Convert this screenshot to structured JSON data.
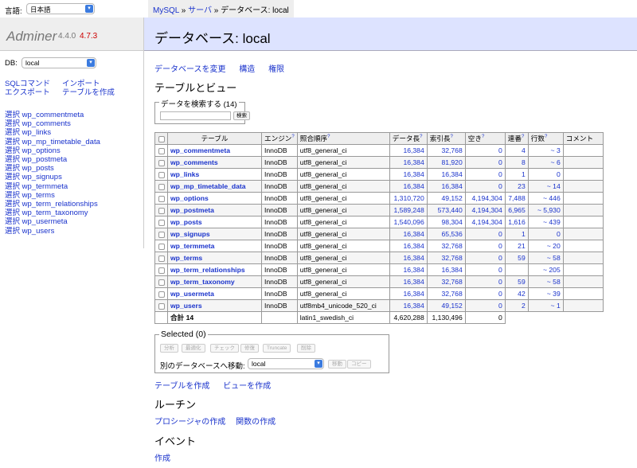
{
  "lang": {
    "label": "言語:",
    "value": "日本語"
  },
  "app": {
    "name": "Adminer",
    "version": "4.4.0",
    "new_version": "4.7.3"
  },
  "db": {
    "label": "DB:",
    "value": "local"
  },
  "side_links": [
    "SQLコマンド",
    "インポート",
    "エクスポート",
    "テーブルを作成"
  ],
  "select_prefix": "選択",
  "breadcrumb": {
    "mysql": "MySQL",
    "sep": "»",
    "server": "サーバ",
    "current": "データベース: local"
  },
  "header": {
    "title": "データベース: local"
  },
  "db_links": [
    "データベースを変更",
    "構造",
    "権限"
  ],
  "tables_heading": "テーブルとビュー",
  "search": {
    "legend": "データを検索する (14)",
    "button": "検索",
    "value": ""
  },
  "columns": [
    "テーブル",
    "エンジン",
    "照合順序",
    "データ長",
    "索引長",
    "空き",
    "連番",
    "行数",
    "コメント"
  ],
  "rows": [
    {
      "name": "wp_commentmeta",
      "engine": "InnoDB",
      "collation": "utf8_general_ci",
      "data": "16,384",
      "index": "32,768",
      "free": "0",
      "ai": "4",
      "rows": "~ 3"
    },
    {
      "name": "wp_comments",
      "engine": "InnoDB",
      "collation": "utf8_general_ci",
      "data": "16,384",
      "index": "81,920",
      "free": "0",
      "ai": "8",
      "rows": "~ 6"
    },
    {
      "name": "wp_links",
      "engine": "InnoDB",
      "collation": "utf8_general_ci",
      "data": "16,384",
      "index": "16,384",
      "free": "0",
      "ai": "1",
      "rows": "0"
    },
    {
      "name": "wp_mp_timetable_data",
      "engine": "InnoDB",
      "collation": "utf8_general_ci",
      "data": "16,384",
      "index": "16,384",
      "free": "0",
      "ai": "23",
      "rows": "~ 14"
    },
    {
      "name": "wp_options",
      "engine": "InnoDB",
      "collation": "utf8_general_ci",
      "data": "1,310,720",
      "index": "49,152",
      "free": "4,194,304",
      "ai": "7,488",
      "rows": "~ 446"
    },
    {
      "name": "wp_postmeta",
      "engine": "InnoDB",
      "collation": "utf8_general_ci",
      "data": "1,589,248",
      "index": "573,440",
      "free": "4,194,304",
      "ai": "6,965",
      "rows": "~ 5,930"
    },
    {
      "name": "wp_posts",
      "engine": "InnoDB",
      "collation": "utf8_general_ci",
      "data": "1,540,096",
      "index": "98,304",
      "free": "4,194,304",
      "ai": "1,616",
      "rows": "~ 439"
    },
    {
      "name": "wp_signups",
      "engine": "InnoDB",
      "collation": "utf8_general_ci",
      "data": "16,384",
      "index": "65,536",
      "free": "0",
      "ai": "1",
      "rows": "0"
    },
    {
      "name": "wp_termmeta",
      "engine": "InnoDB",
      "collation": "utf8_general_ci",
      "data": "16,384",
      "index": "32,768",
      "free": "0",
      "ai": "21",
      "rows": "~ 20"
    },
    {
      "name": "wp_terms",
      "engine": "InnoDB",
      "collation": "utf8_general_ci",
      "data": "16,384",
      "index": "32,768",
      "free": "0",
      "ai": "59",
      "rows": "~ 58"
    },
    {
      "name": "wp_term_relationships",
      "engine": "InnoDB",
      "collation": "utf8_general_ci",
      "data": "16,384",
      "index": "16,384",
      "free": "0",
      "ai": "",
      "rows": "~ 205"
    },
    {
      "name": "wp_term_taxonomy",
      "engine": "InnoDB",
      "collation": "utf8_general_ci",
      "data": "16,384",
      "index": "32,768",
      "free": "0",
      "ai": "59",
      "rows": "~ 58"
    },
    {
      "name": "wp_usermeta",
      "engine": "InnoDB",
      "collation": "utf8_general_ci",
      "data": "16,384",
      "index": "32,768",
      "free": "0",
      "ai": "42",
      "rows": "~ 39"
    },
    {
      "name": "wp_users",
      "engine": "InnoDB",
      "collation": "utf8mb4_unicode_520_ci",
      "data": "16,384",
      "index": "49,152",
      "free": "0",
      "ai": "2",
      "rows": "~ 1"
    }
  ],
  "total": {
    "label": "合計 14",
    "collation": "latin1_swedish_ci",
    "data": "4,620,288",
    "index": "1,130,496",
    "free": "0"
  },
  "selected": {
    "legend": "Selected (0)",
    "buttons": [
      "分析",
      "最適化",
      "チェック",
      "修復",
      "Truncate",
      "削除"
    ],
    "move_label": "別のデータベースへ移動:",
    "move_db": "local",
    "move_btn": "移動",
    "copy_btn": "コピー"
  },
  "create_links": [
    "テーブルを作成",
    "ビューを作成"
  ],
  "routines_heading": "ルーチン",
  "routine_links": [
    "プロシージャの作成",
    "関数の作成"
  ],
  "events_heading": "イベント",
  "event_link": "作成"
}
